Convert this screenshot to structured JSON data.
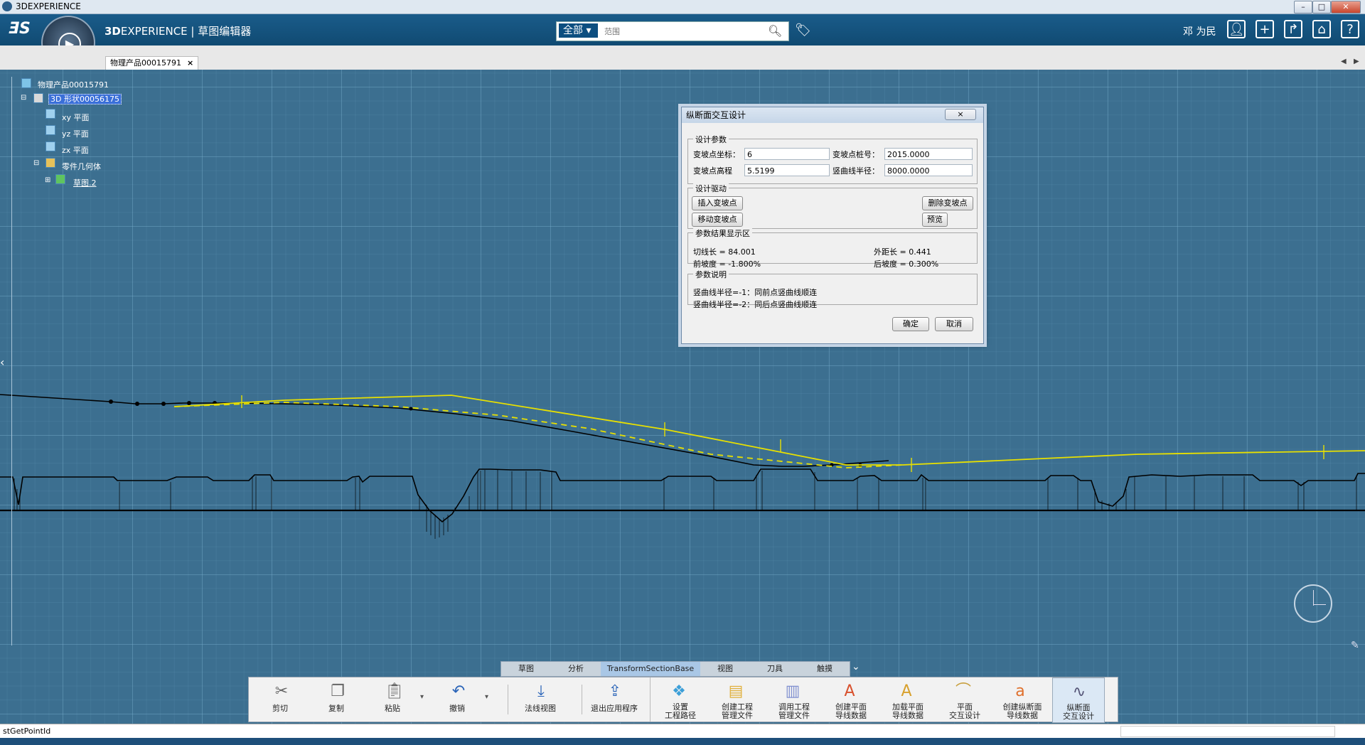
{
  "window": {
    "title": "3DEXPERIENCE"
  },
  "header": {
    "app_title_bold": "3D",
    "app_title_rest": "EXPERIENCE | 草图编辑器",
    "search_scope": "全部",
    "search_placeholder": "范围",
    "username": "邓 为民"
  },
  "tabs": {
    "doc_tab": "物理产品00015791",
    "close": "×"
  },
  "tree": {
    "root": "物理产品00015791",
    "shape": "3D 形状00056175",
    "items": [
      "xy 平面",
      "yz 平面",
      "zx 平面",
      "零件几何体",
      "草图.2"
    ]
  },
  "dialog": {
    "title": "纵断面交互设计",
    "close": "×",
    "group_params": "设计参数",
    "point_coord_label": "变坡点坐标：",
    "point_coord_value": "6",
    "station_label": "变坡点桩号：",
    "station_value": "2015.0000",
    "elevation_label": "变坡点高程",
    "elevation_value": "5.5199",
    "radius_label": "竖曲线半径：",
    "radius_value": "8000.0000",
    "group_drive": "设计驱动",
    "insert_btn": "插入变坡点",
    "delete_btn": "删除变坡点",
    "move_btn": "移动变坡点",
    "preview_btn": "预览",
    "group_result": "参数结果显示区",
    "tangent": "切线长 = 84.001",
    "external": "外距长 = 0.441",
    "front_slope": "前坡度 = -1.800%",
    "back_slope": "后坡度 = 0.300%",
    "group_note": "参数说明",
    "note1": "竖曲线半径=-1：同前点竖曲线顺连",
    "note2": "竖曲线半径=-2：同后点竖曲线顺连",
    "ok_btn": "确定",
    "cancel_btn": "取消"
  },
  "section_tabs": [
    "草图",
    "分析",
    "TransformSectionBase",
    "视图",
    "刀具",
    "触摸"
  ],
  "toolbar": {
    "cut": "剪切",
    "copy": "复制",
    "paste": "粘贴",
    "undo": "撤销",
    "normal_view": "法线视图",
    "exit_app": "退出应用程序",
    "set_path": "设置\n工程路径",
    "create_mgmt": "创建工程\n管理文件",
    "call_mgmt": "调用工程\n管理文件",
    "create_plane": "创建平面\n导线数据",
    "load_plane": "加载平面\n导线数据",
    "plane_interact": "平面\n交互设计",
    "create_profile": "创建纵断面\n导线数据",
    "profile_interact": "纵断面\n交互设计"
  },
  "status": {
    "text": "stGetPointId"
  },
  "colors": {
    "header_bg": "#104a72",
    "canvas_bg": "#3c6f90",
    "design_line": "#e8e000",
    "terrain": "#000000"
  }
}
